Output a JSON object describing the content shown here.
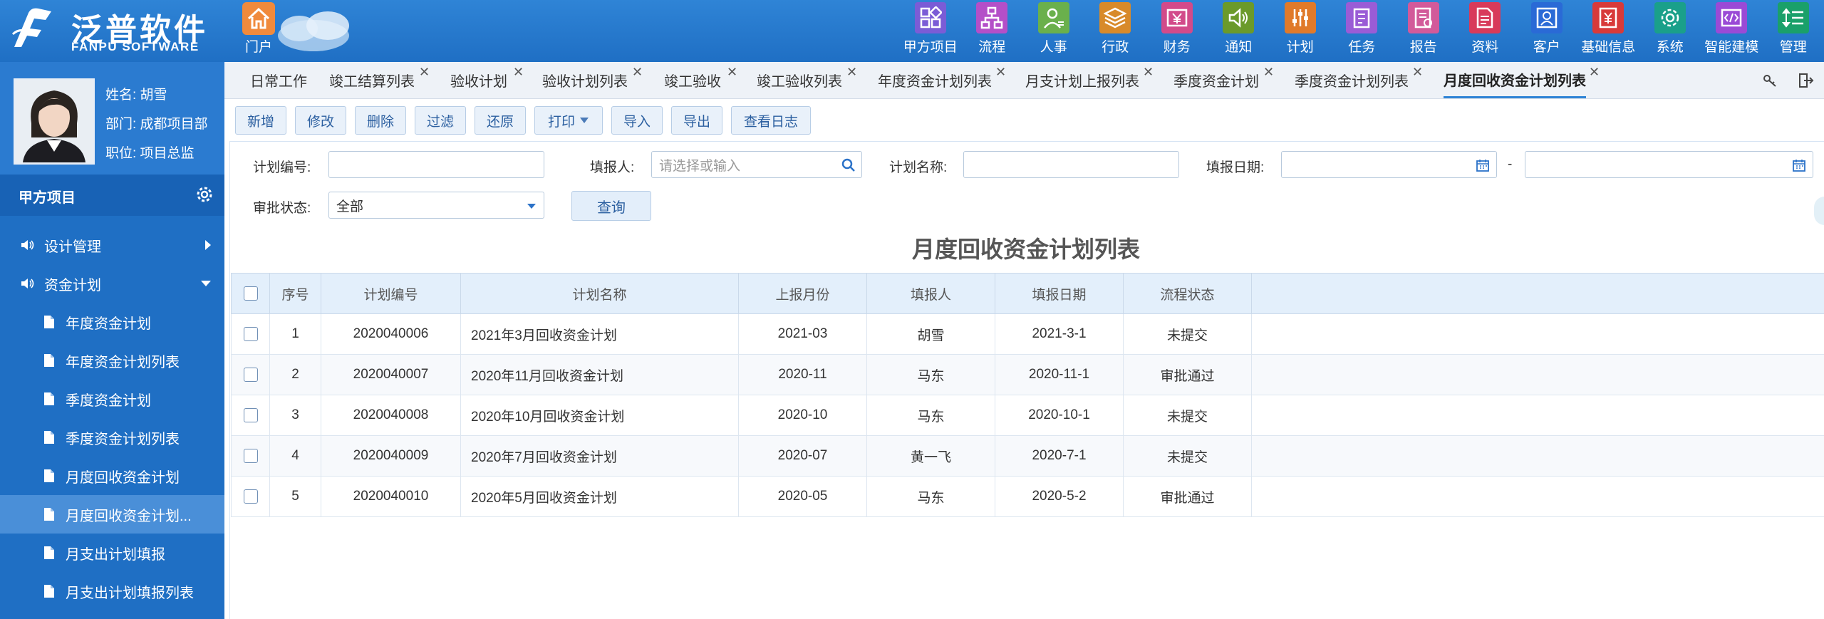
{
  "brand": {
    "cn": "泛普软件",
    "en": "FANPU SOFTWARE"
  },
  "home": {
    "label": "门户"
  },
  "nav": [
    {
      "label": "甲方项目",
      "icon": "grid-icon",
      "color": "#7b5cd6"
    },
    {
      "label": "流程",
      "icon": "flow-icon",
      "color": "#b44fc8"
    },
    {
      "label": "人事",
      "icon": "person-icon",
      "color": "#6ab04c"
    },
    {
      "label": "行政",
      "icon": "layers-icon",
      "color": "#d88a2a"
    },
    {
      "label": "财务",
      "icon": "yen-icon",
      "color": "#d24a8a"
    },
    {
      "label": "通知",
      "icon": "speaker-icon",
      "color": "#6b9a2a"
    },
    {
      "label": "计划",
      "icon": "sliders-icon",
      "color": "#e07a2a"
    },
    {
      "label": "任务",
      "icon": "clipboard-icon",
      "color": "#9a5cd6"
    },
    {
      "label": "报告",
      "icon": "report-icon",
      "color": "#d25a9a"
    },
    {
      "label": "资料",
      "icon": "document-icon",
      "color": "#d83a5a"
    },
    {
      "label": "客户",
      "icon": "customer-icon",
      "color": "#2a6ad6"
    },
    {
      "label": "基础信息",
      "icon": "info-icon",
      "color": "#d83a3a"
    },
    {
      "label": "系统",
      "icon": "gear-icon",
      "color": "#1aa08a"
    },
    {
      "label": "智能建模",
      "icon": "code-icon",
      "color": "#9a4ad6"
    },
    {
      "label": "管理",
      "icon": "list-icon",
      "color": "#1aa06a"
    }
  ],
  "profile": {
    "name": "姓名: 胡雪",
    "dept": "部门: 成都项目部",
    "title": "职位: 项目总监"
  },
  "sidebar": {
    "section": "甲方项目",
    "items": [
      {
        "label": "设计管理",
        "level": "top",
        "arrow": "right"
      },
      {
        "label": "资金计划",
        "level": "top",
        "arrow": "down"
      },
      {
        "label": "年度资金计划",
        "level": "sub"
      },
      {
        "label": "年度资金计划列表",
        "level": "sub"
      },
      {
        "label": "季度资金计划",
        "level": "sub"
      },
      {
        "label": "季度资金计划列表",
        "level": "sub"
      },
      {
        "label": "月度回收资金计划",
        "level": "sub"
      },
      {
        "label": "月度回收资金计划...",
        "level": "sub",
        "active": true
      },
      {
        "label": "月支出计划填报",
        "level": "sub"
      },
      {
        "label": "月支出计划填报列表",
        "level": "sub"
      }
    ]
  },
  "tabs": [
    {
      "label": "日常工作",
      "closable": false
    },
    {
      "label": "竣工结算列表",
      "closable": true
    },
    {
      "label": "验收计划",
      "closable": true
    },
    {
      "label": "验收计划列表",
      "closable": true
    },
    {
      "label": "竣工验收",
      "closable": true
    },
    {
      "label": "竣工验收列表",
      "closable": true
    },
    {
      "label": "年度资金计划列表",
      "closable": true
    },
    {
      "label": "月支计划上报列表",
      "closable": true
    },
    {
      "label": "季度资金计划",
      "closable": true
    },
    {
      "label": "季度资金计划列表",
      "closable": true
    },
    {
      "label": "月度回收资金计划列表",
      "closable": true,
      "active": true
    }
  ],
  "toolbar": {
    "add": "新增",
    "edit": "修改",
    "delete": "删除",
    "filter": "过滤",
    "restore": "还原",
    "print": "打印",
    "import": "导入",
    "export": "导出",
    "log": "查看日志"
  },
  "filters": {
    "plan_no_label": "计划编号:",
    "reporter_label": "填报人:",
    "reporter_placeholder": "请选择或输入",
    "plan_name_label": "计划名称:",
    "date_label": "填报日期:",
    "date_sep": "-",
    "status_label": "审批状态:",
    "status_value": "全部",
    "query": "查询"
  },
  "list_title": "月度回收资金计划列表",
  "table": {
    "headers": [
      "序号",
      "计划编号",
      "计划名称",
      "上报月份",
      "填报人",
      "填报日期",
      "流程状态"
    ],
    "rows": [
      {
        "seq": "1",
        "no": "2020040006",
        "name": "2021年3月回收资金计划",
        "month": "2021-03",
        "reporter": "胡雪",
        "date": "2021-3-1",
        "status": "未提交"
      },
      {
        "seq": "2",
        "no": "2020040007",
        "name": "2020年11月回收资金计划",
        "month": "2020-11",
        "reporter": "马东",
        "date": "2020-11-1",
        "status": "审批通过"
      },
      {
        "seq": "3",
        "no": "2020040008",
        "name": "2020年10月回收资金计划",
        "month": "2020-10",
        "reporter": "马东",
        "date": "2020-10-1",
        "status": "未提交"
      },
      {
        "seq": "4",
        "no": "2020040009",
        "name": "2020年7月回收资金计划",
        "month": "2020-07",
        "reporter": "黄一飞",
        "date": "2020-7-1",
        "status": "未提交"
      },
      {
        "seq": "5",
        "no": "2020040010",
        "name": "2020年5月回收资金计划",
        "month": "2020-05",
        "reporter": "马东",
        "date": "2020-5-2",
        "status": "审批通过"
      }
    ]
  },
  "colors": {
    "header": "#2f84d6",
    "sidebar": "#1f6fc4",
    "accent": "#2b72c8",
    "approved": "#1a8a1a",
    "pending": "#1a22cc"
  }
}
